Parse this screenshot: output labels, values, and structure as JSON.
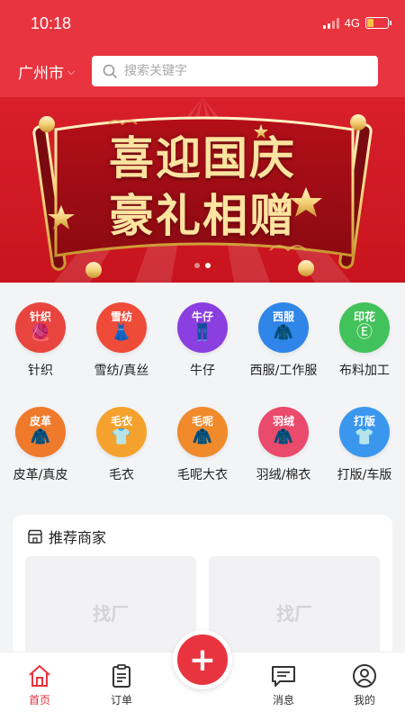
{
  "status": {
    "time": "10:18",
    "network": "4G"
  },
  "header": {
    "city": "广州市",
    "search_placeholder": "搜索关键字"
  },
  "banner": {
    "line1": "喜迎国庆",
    "line2": "豪礼相赠",
    "slide_count": 2,
    "active_slide": 1
  },
  "categories": [
    {
      "tag": "针织",
      "label": "针织",
      "color": "#e8453f",
      "glyph": "🧶"
    },
    {
      "tag": "雪纺",
      "label": "雪纺/真丝",
      "color": "#ee4b38",
      "glyph": "👗"
    },
    {
      "tag": "牛仔",
      "label": "牛仔",
      "color": "#8b3fe0",
      "glyph": "👖"
    },
    {
      "tag": "西服",
      "label": "西服/工作服",
      "color": "#2f86e8",
      "glyph": "🧥"
    },
    {
      "tag": "印花",
      "label": "布料加工",
      "color": "#42c25a",
      "glyph": "Ⓔ"
    },
    {
      "tag": "皮革",
      "label": "皮革/真皮",
      "color": "#ef7a2c",
      "glyph": "🧥"
    },
    {
      "tag": "毛衣",
      "label": "毛衣",
      "color": "#f4a22d",
      "glyph": "👕"
    },
    {
      "tag": "毛呢",
      "label": "毛呢大衣",
      "color": "#f08a2b",
      "glyph": "🧥"
    },
    {
      "tag": "羽绒",
      "label": "羽绒/棉衣",
      "color": "#ea4a6b",
      "glyph": "🧥"
    },
    {
      "tag": "打版",
      "label": "打版/车版",
      "color": "#3b97ee",
      "glyph": "👕"
    }
  ],
  "recommend": {
    "title": "推荐商家",
    "placeholders": [
      "找厂",
      "找厂"
    ]
  },
  "tabbar": {
    "items": [
      {
        "label": "首页",
        "icon": "home-icon",
        "active": true
      },
      {
        "label": "订单",
        "icon": "clipboard-icon",
        "active": false
      },
      {
        "label": "消息",
        "icon": "message-icon",
        "active": false
      },
      {
        "label": "我的",
        "icon": "user-icon",
        "active": false
      }
    ],
    "fab_symbol": "+"
  },
  "colors": {
    "brand": "#e8343f",
    "banner_gold": "#f5d27a"
  }
}
